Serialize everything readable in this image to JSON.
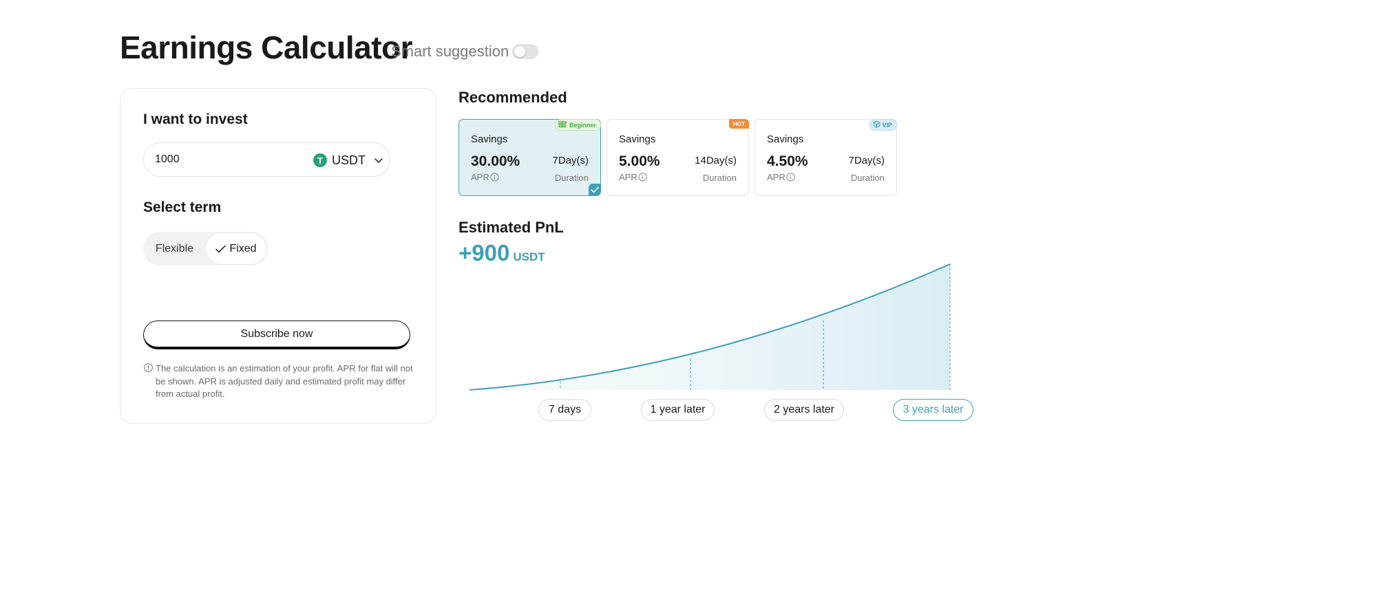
{
  "header": {
    "title": "Earnings Calculator",
    "smart_suggestion_label": "Smart suggestion",
    "smart_suggestion_on": false
  },
  "invest": {
    "label": "I want to invest",
    "amount": "1000",
    "currency": "USDT",
    "currency_icon_glyph": "T",
    "currency_icon": "usdt-coin-icon"
  },
  "term": {
    "label": "Select term",
    "options": [
      "Flexible",
      "Fixed"
    ],
    "selected": "Fixed"
  },
  "subscribe_label": "Subscribe now",
  "disclaimer": "The calculation is an estimation of your profit. APR for flat will not be shown. APR is adjusted daily and estimated profit may differ from actual profit.",
  "recommended": {
    "title": "Recommended",
    "products": [
      {
        "name": "Savings",
        "apr": "30.00%",
        "apr_label": "APR",
        "duration": "7Day(s)",
        "duration_label": "Duration",
        "badge": "Beginner",
        "selected": true
      },
      {
        "name": "Savings",
        "apr": "5.00%",
        "apr_label": "APR",
        "duration": "14Day(s)",
        "duration_label": "Duration",
        "badge": "HOT",
        "selected": false
      },
      {
        "name": "Savings",
        "apr": "4.50%",
        "apr_label": "APR",
        "duration": "7Day(s)",
        "duration_label": "Duration",
        "badge": "VIP",
        "selected": false
      }
    ]
  },
  "pnl": {
    "title": "Estimated PnL",
    "amount": "+900",
    "unit": "USDT"
  },
  "time_points": [
    "7 days",
    "1 year later",
    "2 years later",
    "3 years later"
  ],
  "selected_time_point": "3 years later",
  "colors": {
    "accent": "#3e9fb7",
    "selected_card_bg": "#e2f0f3",
    "usdt_green": "#26a17b",
    "hot_orange": "#f28c3b",
    "beginner_green": "#46a84a"
  }
}
